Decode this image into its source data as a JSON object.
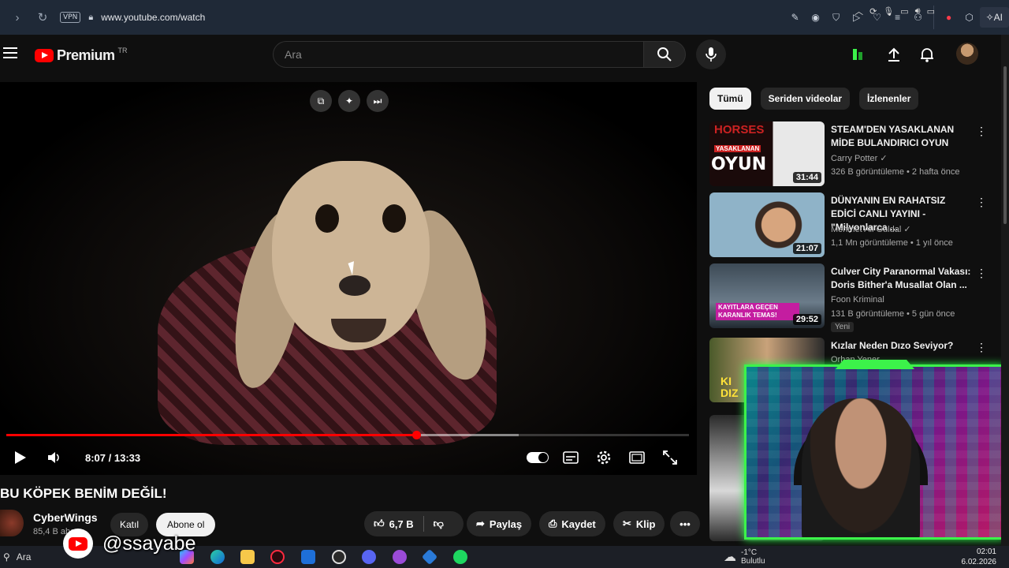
{
  "browser": {
    "url": "www.youtube.com/watch",
    "vpn_label": "VPN",
    "ai_label": "AI"
  },
  "header": {
    "logo_text": "Premium",
    "logo_region": "TR",
    "search_placeholder": "Ara"
  },
  "player": {
    "time": "8:07 / 13:33",
    "progress_fraction": 0.6,
    "buffered_fraction": 0.75
  },
  "video": {
    "title": "BU KÖPEK BENİM DEĞİL!",
    "channel_name": "CyberWings",
    "channel_subs": "85,4 B abone",
    "join_label": "Katıl",
    "subscribe_label": "Abone ol",
    "likes": "6,7 B",
    "share_label": "Paylaş",
    "save_label": "Kaydet",
    "clip_label": "Klip"
  },
  "watermark": {
    "handle": "@ssayabe"
  },
  "chips": [
    "Tümü",
    "Seriden videolar",
    "İzlenenler"
  ],
  "recommendations": [
    {
      "title": "STEAM'DEN YASAKLANAN MİDE BULANDIRICI OYUN",
      "channel": "Carry Potter",
      "meta": "326 B görüntüleme • 2 hafta önce",
      "duration": "31:44",
      "thumb_text": "OYUN",
      "thumb_sub": "YASAKLANAN",
      "thumb_top": "HORSES"
    },
    {
      "title": "DÜNYANIN EN RAHATSIZ EDİCİ CANLI YAYINI - \"Milyonlarca ...",
      "channel": "Mehmet Ali Güldal",
      "meta": "1,1 Mn görüntüleme • 1 yıl önce",
      "duration": "21:07"
    },
    {
      "title": "Culver City Paranormal Vakası: Doris Bither'a Musallat Olan ...",
      "channel": "Foon Kriminal",
      "meta": "131 B görüntüleme • 5 gün önce",
      "duration": "29:52",
      "badge": "Yeni",
      "thumb_text": "KAYITLARA GEÇEN KARANLIK TEMAS!"
    },
    {
      "title": "Kızlar Neden Dızo Seviyor?",
      "channel": "Orhan Yener",
      "thumb_text": "KI DIZ"
    }
  ],
  "taskbar": {
    "search_label": "Ara",
    "temperature": "-1°C",
    "weather": "Bulutlu",
    "time": "02:01",
    "date": "6.02.2026"
  },
  "colors": {
    "accent": "#ff0000",
    "cam_border": "#3cf24a"
  }
}
